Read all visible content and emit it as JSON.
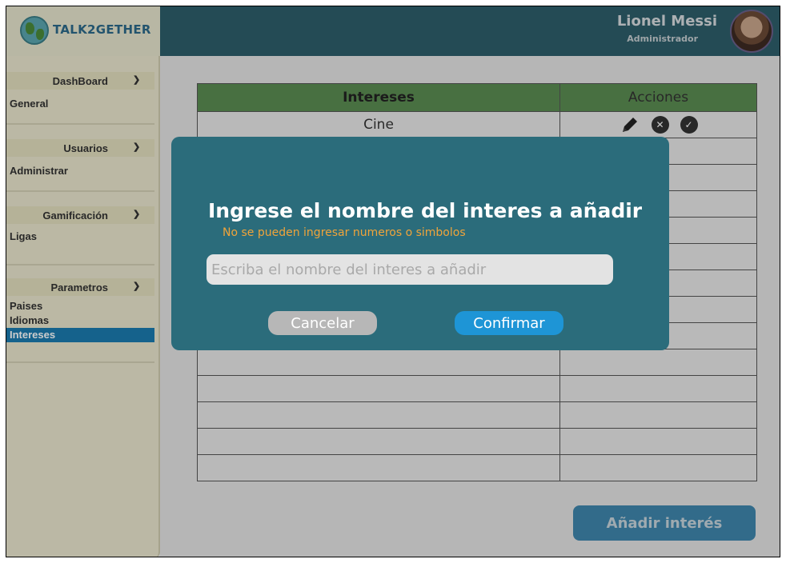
{
  "app": {
    "logo_text": "TALK2GETHER"
  },
  "user": {
    "name": "Lionel Messi",
    "role": "Administrador"
  },
  "sidebar": {
    "sections": [
      {
        "title": "DashBoard",
        "items": [
          "General"
        ]
      },
      {
        "title": "Usuarios",
        "items": [
          "Administrar"
        ]
      },
      {
        "title": "Gamificación",
        "items": [
          "Ligas"
        ]
      },
      {
        "title": "Parametros",
        "items": [
          "Paises",
          "Idiomas",
          "Intereses"
        ],
        "active": "Intereses"
      }
    ]
  },
  "table": {
    "headers": [
      "Intereses",
      "Acciones"
    ],
    "rows": [
      {
        "interes": "Cine"
      }
    ]
  },
  "add_button": "Añadir interés",
  "modal": {
    "title": "Ingrese el nombre del interes a añadir",
    "hint": "No se pueden ingresar numeros o simbolos",
    "input_placeholder": "Escriba el nombre del interes a añadir",
    "input_value": "",
    "cancel": "Cancelar",
    "confirm": "Confirmar"
  },
  "colors": {
    "header_bg": "#2e5e6b",
    "sidebar_bg": "#eae7cf",
    "table_header": "#5a8c52",
    "modal_bg": "#2b6c7b",
    "hint": "#f0a43a",
    "confirm": "#1e95d6",
    "cancel": "#b7b7b7",
    "active_item": "#1b7bb0"
  },
  "icons": [
    "globe-logo-icon",
    "chevron-down-icon",
    "pencil-icon",
    "x-circle-icon",
    "check-circle-icon"
  ]
}
